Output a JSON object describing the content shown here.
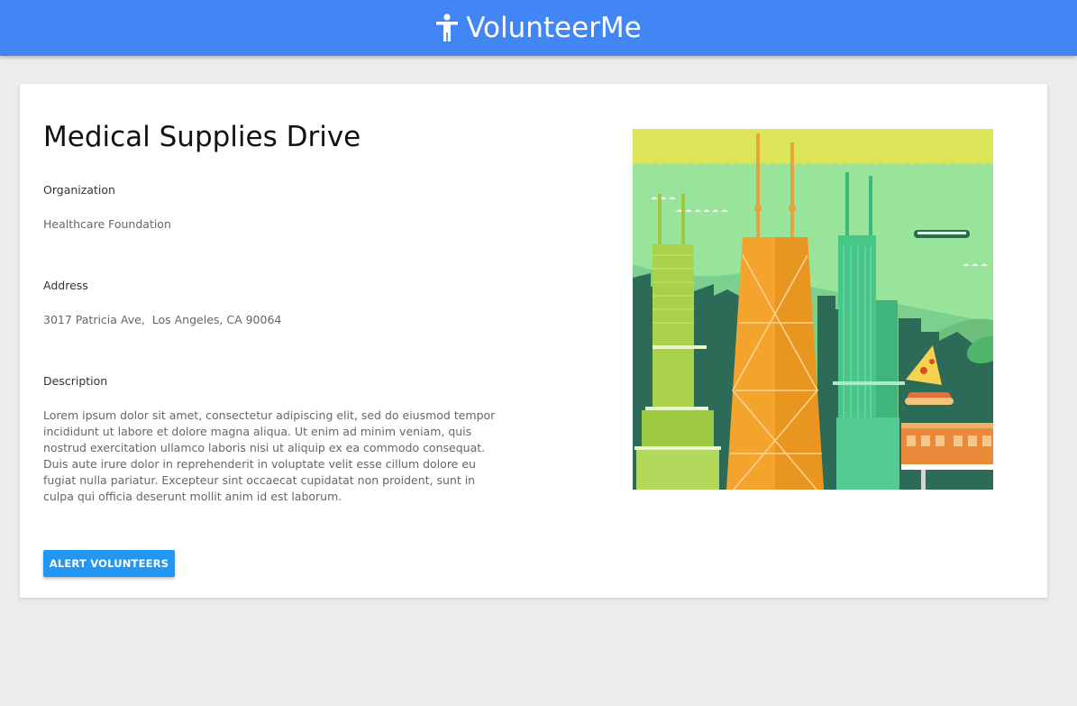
{
  "app": {
    "title": "VolunteerMe",
    "icon": "person-icon",
    "header_color": "#4285f4"
  },
  "event": {
    "title": "Medical Supplies Drive",
    "organization_label": "Organization",
    "organization": "Healthcare Foundation",
    "address_label": "Address",
    "address": "3017 Patricia Ave,  Los Angeles, CA 90064",
    "description_label": "Description",
    "description": "Lorem ipsum dolor sit amet, consectetur adipiscing elit, sed do eiusmod tempor incididunt ut labore et dolore magna aliqua. Ut enim ad minim veniam, quis nostrud exercitation ullamco laboris nisi ut aliquip ex ea commodo consequat. Duis aute irure dolor in reprehenderit in voluptate velit esse cillum dolore eu fugiat nulla pariatur. Excepteur sint occaecat cupidatat non proident, sunt in culpa qui officia deserunt mollit anim id est laborum."
  },
  "actions": {
    "alert_label": "ALERT VOLUNTEERS",
    "alert_color": "#2196f3"
  }
}
